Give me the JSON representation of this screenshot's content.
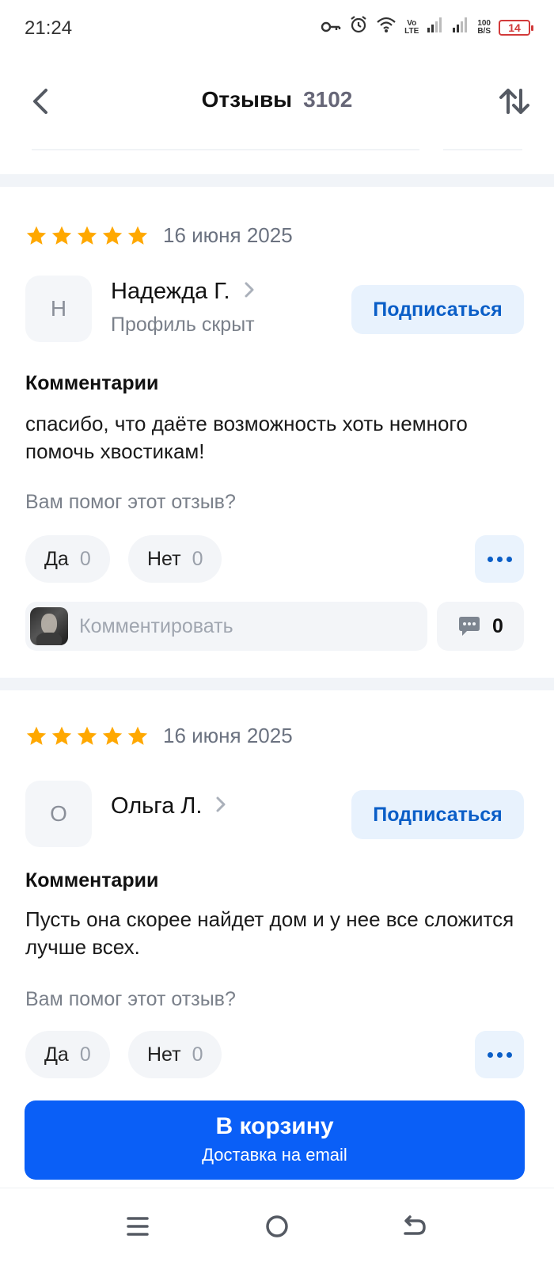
{
  "status_bar": {
    "time": "21:24",
    "icons": [
      "key-icon",
      "alarm-icon",
      "wifi-icon",
      "volte-icon",
      "signal-icon",
      "signal-icon",
      "net-speed-icon",
      "battery-icon"
    ],
    "volte_top": "Vo",
    "volte_bottom": "LTE",
    "speed_top": "100",
    "speed_bottom": "B/S",
    "battery": "14"
  },
  "header": {
    "title": "Отзывы",
    "count": "3102",
    "back_icon": "chevron-left-icon",
    "sort_icon": "sort-arrows-icon"
  },
  "reviews": [
    {
      "rating": 5,
      "date": "16 июня 2025",
      "avatar_letter": "Н",
      "author": "Надежда Г.",
      "author_sub": "Профиль скрыт",
      "subscribe_label": "Подписаться",
      "section_label": "Комментарии",
      "text": "спасибо, что даёте возможность хоть немного помочь хвостикам!",
      "helpful_question": "Вам помог этот отзыв?",
      "yes_label": "Да",
      "yes_count": "0",
      "no_label": "Нет",
      "no_count": "0",
      "comment_placeholder": "Комментировать",
      "comments_count": "0"
    },
    {
      "rating": 5,
      "date": "16 июня 2025",
      "avatar_letter": "О",
      "author": "Ольга Л.",
      "subscribe_label": "Подписаться",
      "section_label": "Комментарии",
      "text": "Пусть она скорее найдет дом и у нее все сложится лучше всех.",
      "helpful_question": "Вам помог этот отзыв?",
      "yes_label": "Да",
      "yes_count": "0",
      "no_label": "Нет",
      "no_count": "0"
    }
  ],
  "cart_button": {
    "title": "В корзину",
    "subtitle": "Доставка на email"
  },
  "nav_bar": {
    "items": [
      "menu-icon",
      "home-icon",
      "back-icon"
    ]
  },
  "colors": {
    "accent": "#0a5ff7",
    "star": "#ffa800",
    "subscribe_bg": "#e8f2fd",
    "subscribe_text": "#0a5ec7"
  }
}
